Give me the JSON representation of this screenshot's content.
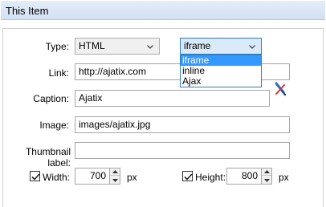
{
  "header": {
    "title": "This Item"
  },
  "form": {
    "type_label": "Type:",
    "type_value": "HTML",
    "mode_value": "iframe",
    "mode_options": [
      "iframe",
      "inline",
      "Ajax"
    ],
    "link_label": "Link:",
    "link_value": "http://ajatix.com",
    "caption_label": "Caption:",
    "caption_value": "Ajatix",
    "image_label": "Image:",
    "image_value": "images/ajatix.jpg",
    "thumbnail_label": "Thumbnail label:",
    "thumbnail_value": "",
    "width_label": "Width:",
    "width_value": "700",
    "width_unit": "px",
    "height_label": "Height:",
    "height_value": "800",
    "height_unit": "px"
  },
  "icons": {
    "clear": "clear-brush-icon",
    "chevron": "chevron-down-icon",
    "spin_up": "spin-up-icon",
    "spin_down": "spin-down-icon",
    "check": "checkmark-icon"
  },
  "colors": {
    "header_bg": "#dae6f5",
    "selection": "#3399ff",
    "focus_border": "#2d7cc6"
  }
}
